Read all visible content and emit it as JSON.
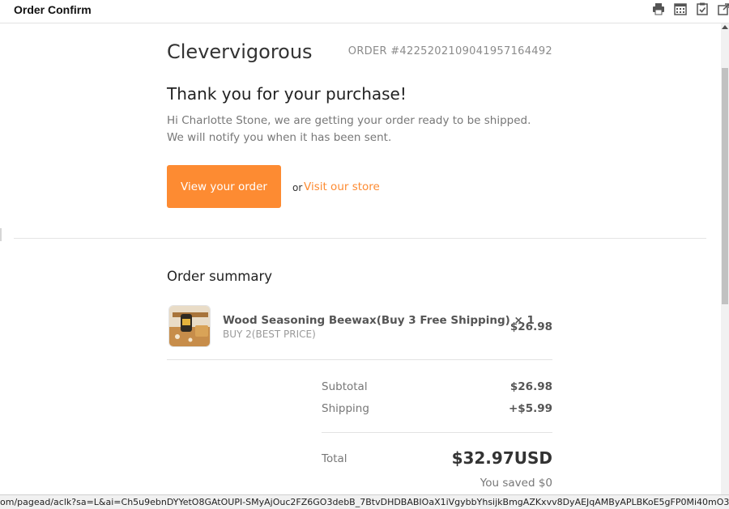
{
  "window": {
    "title": "Order Confirm"
  },
  "toolbar": {
    "icons": [
      "printer-icon",
      "calendar-icon",
      "clipboard-check-icon",
      "popout-icon"
    ]
  },
  "email": {
    "shop_name": "Clevervigorous",
    "order_number": "ORDER #422520210904195716449​2",
    "heading": "Thank you for your purchase!",
    "message": "Hi Charlotte Stone, we are getting your order ready to be shipped. We will notify you when it has been sent.",
    "view_order_label": "View your order",
    "or_text": "or",
    "visit_store_label": "Visit our store",
    "summary_title": "Order summary",
    "item": {
      "name": "Wood Seasoning Beewax(Buy 3 Free Shipping) × 1",
      "variant": "BUY 2(BEST PRICE)",
      "price": "$26.98"
    },
    "subtotal_label": "Subtotal",
    "subtotal_value": "$26.98",
    "shipping_label": "Shipping",
    "shipping_value": "+$5.99",
    "total_label": "Total",
    "total_value": "$32.97USD",
    "saved_text": "You saved $0"
  },
  "status_bar": {
    "url": "om/pagead/aclk?sa=L&ai=Ch5u9ebnDYYetO8GAtOUPI-SMyAjOuc2FZ6GO3debB_7BtvDHDBABIOaX1iVgybbYhsijkBmgAZKxvv8DyAEJqAMByAPLBKoE5gFP0Mi40mO3PY-o6vD2lsX6qMPp_LmP4HIEIP3h"
  },
  "colors": {
    "accent": "#fd8b32",
    "text_dark": "#333333",
    "text_muted": "#777777"
  }
}
